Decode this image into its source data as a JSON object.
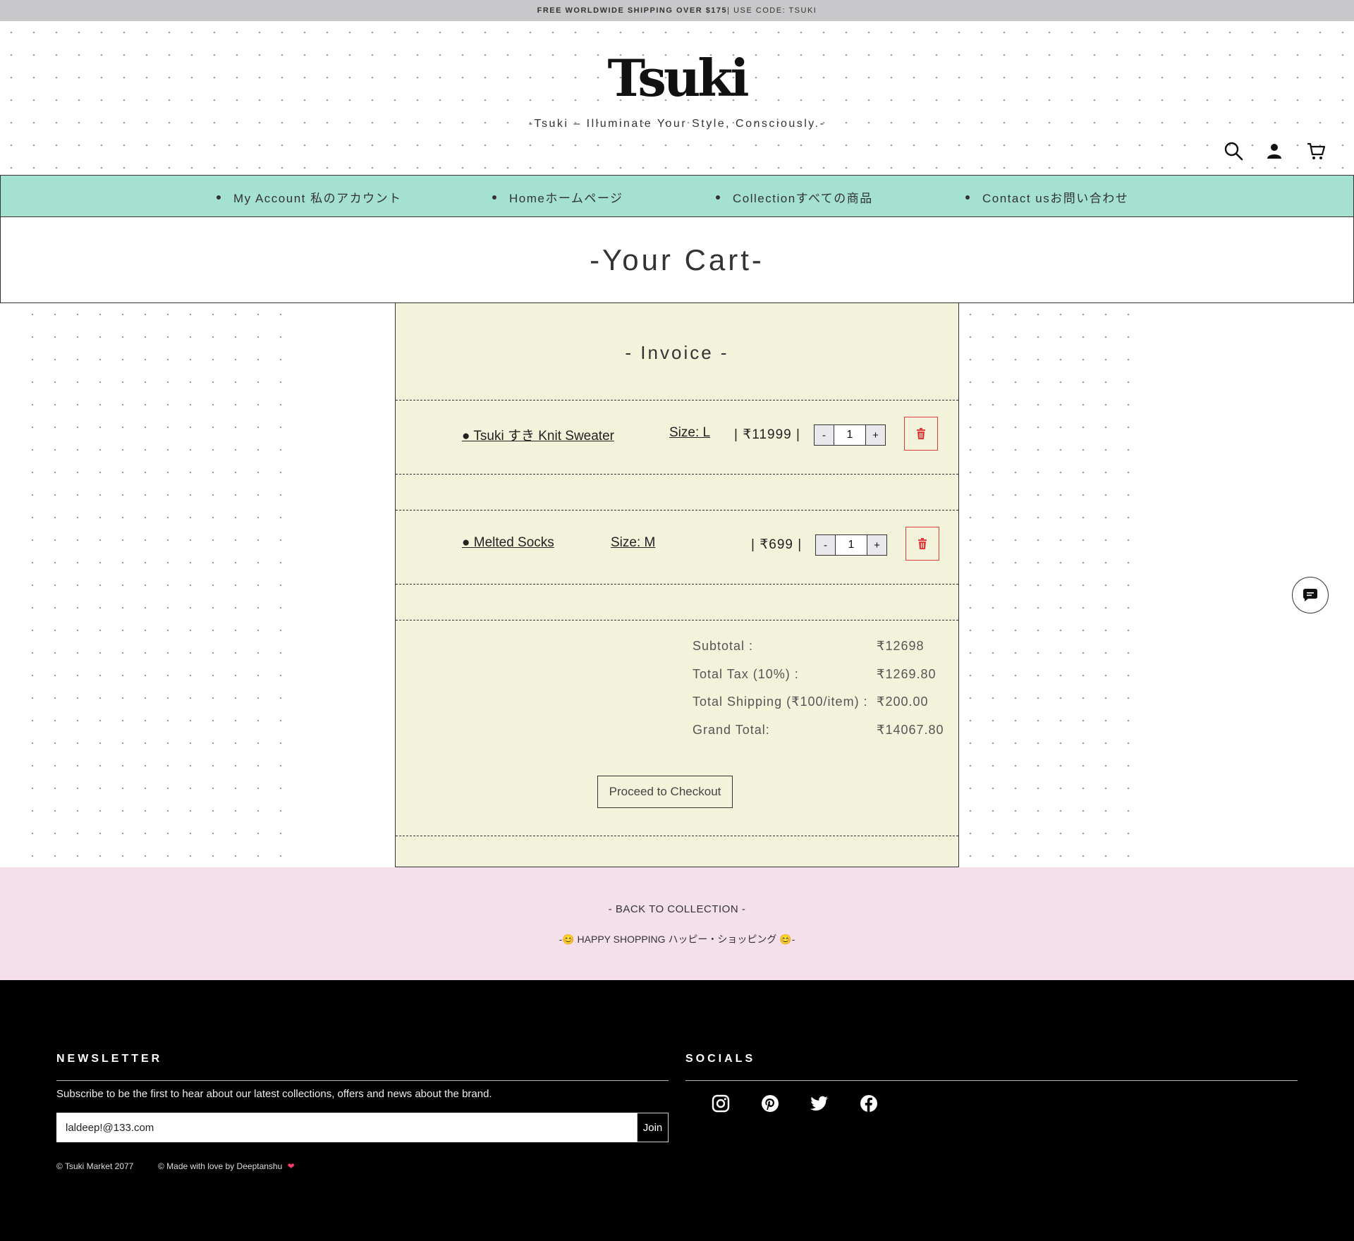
{
  "announcement": {
    "bold": "FREE WORLDWIDE SHIPPING OVER $175",
    "rest": " | USE CODE: TSUKI"
  },
  "header": {
    "logo": "Tsuki",
    "tagline": "-Tsuki – Illuminate Your Style, Consciously.-",
    "icons": [
      "search-icon",
      "account-icon",
      "cart-icon"
    ]
  },
  "nav": {
    "items": [
      {
        "label": "My Account 私のアカウント"
      },
      {
        "label": "Homeホームページ"
      },
      {
        "label": "Collectionすべての商品"
      },
      {
        "label": "Contact usお問い合わせ"
      }
    ]
  },
  "page": {
    "title": "-Your Cart-"
  },
  "invoice": {
    "title": "- Invoice -",
    "items": [
      {
        "name": "● Tsuki すき Knit Sweater",
        "size": "Size: L",
        "price": "| ₹11999 |",
        "qty": "1",
        "minus": "-",
        "plus": "+"
      },
      {
        "name": "● Melted Socks",
        "size": "Size: M",
        "price": "| ₹699 |",
        "qty": "1",
        "minus": "-",
        "plus": "+"
      }
    ],
    "totals": [
      {
        "label": "Subtotal :",
        "value": "₹12698"
      },
      {
        "label": "Total Tax (10%) :",
        "value": "₹1269.80"
      },
      {
        "label": "Total Shipping (₹100/item) :",
        "value": "₹200.00"
      },
      {
        "label": "Grand Total:",
        "value": "₹14067.80"
      }
    ],
    "checkout_label": "Proceed to Checkout"
  },
  "band": {
    "back_link": "- BACK TO COLLECTION -",
    "happy": "-😊 HAPPY SHOPPING ハッピー・ショッピング 😊-"
  },
  "footer": {
    "newsletter_heading": "NEWSLETTER",
    "newsletter_text": "Subscribe to be the first to hear about our latest collections, offers and news about the brand.",
    "email_value": "laldeep!@133.com",
    "join_label": "Join",
    "socials_heading": "SOCIALS",
    "socials": [
      "instagram-icon",
      "pinterest-icon",
      "twitter-icon",
      "facebook-icon"
    ],
    "copyright": "© Tsuki Market 2077",
    "credit": "© Made with love by Deeptanshu"
  },
  "colors": {
    "nav_bg": "#a4e1d0",
    "invoice_bg": "#f3f3dc",
    "band_bg": "#f3e0ea",
    "delete_red": "#e03a3a",
    "announce_bg": "#c8c7c9"
  }
}
